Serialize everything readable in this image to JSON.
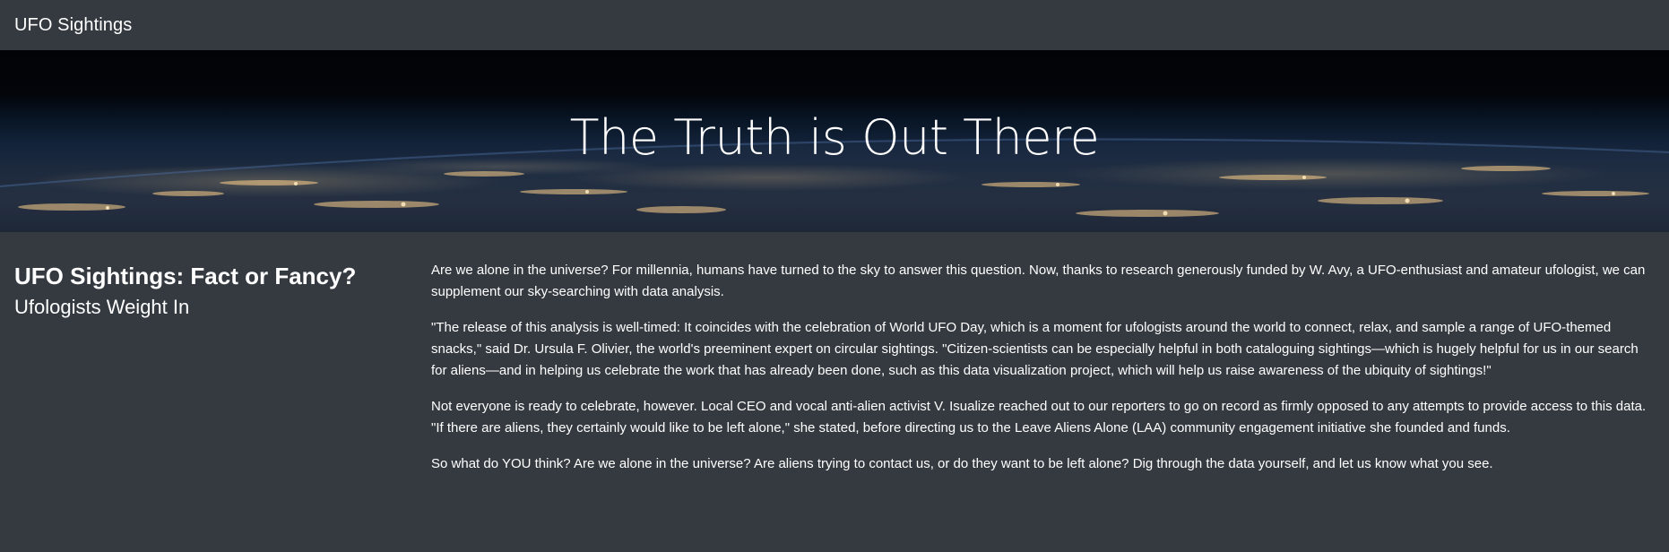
{
  "navbar": {
    "brand": "UFO Sightings"
  },
  "hero": {
    "title": "The Truth is Out There"
  },
  "sidebar": {
    "heading": "UFO Sightings: Fact or Fancy?",
    "subheading": "Ufologists Weight In"
  },
  "article": {
    "paragraphs": [
      "Are we alone in the universe? For millennia, humans have turned to the sky to answer this question. Now, thanks to research generously funded by W. Avy, a UFO-enthusiast and amateur ufologist, we can supplement our sky-searching with data analysis.",
      "\"The release of this analysis is well-timed: It coincides with the celebration of World UFO Day, which is a moment for ufologists around the world to connect, relax, and sample a range of UFO-themed snacks,\" said Dr. Ursula F. Olivier, the world's preeminent expert on circular sightings. \"Citizen-scientists can be especially helpful in both cataloguing sightings—which is hugely helpful for us in our search for aliens—and in helping us celebrate the work that has already been done, such as this data visualization project, which will help us raise awareness of the ubiquity of sightings!\"",
      "Not everyone is ready to celebrate, however. Local CEO and vocal anti-alien activist V. Isualize reached out to our reporters to go on record as firmly opposed to any attempts to provide access to this data. \"If there are aliens, they certainly would like to be left alone,\" she stated, before directing us to the Leave Aliens Alone (LAA) community engagement initiative she founded and funds.",
      "So what do YOU think? Are we alone in the universe? Are aliens trying to contact us, or do they want to be left alone? Dig through the data yourself, and let us know what you see."
    ]
  },
  "colors": {
    "background": "#343a40",
    "text": "#ffffff"
  }
}
